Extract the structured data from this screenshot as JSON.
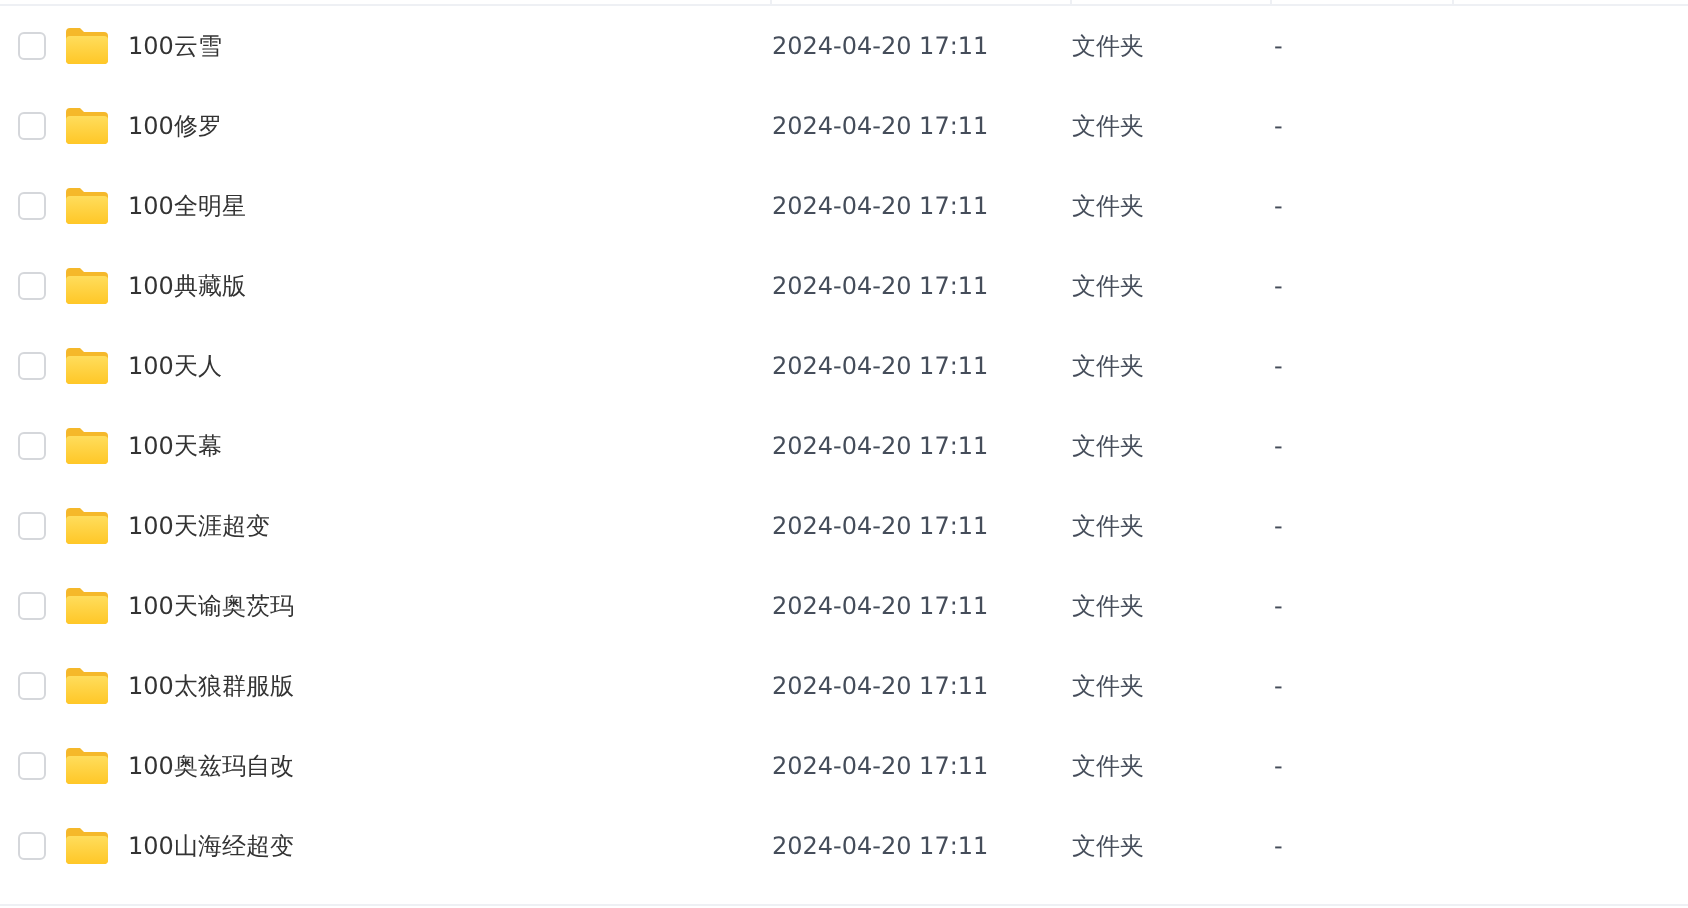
{
  "files": [
    {
      "name": "100云雪",
      "modified": "2024-04-20 17:11",
      "type": "文件夹",
      "size": "-",
      "checked": false
    },
    {
      "name": "100修罗",
      "modified": "2024-04-20 17:11",
      "type": "文件夹",
      "size": "-",
      "checked": false
    },
    {
      "name": "100全明星",
      "modified": "2024-04-20 17:11",
      "type": "文件夹",
      "size": "-",
      "checked": false
    },
    {
      "name": "100典藏版",
      "modified": "2024-04-20 17:11",
      "type": "文件夹",
      "size": "-",
      "checked": false
    },
    {
      "name": "100天人",
      "modified": "2024-04-20 17:11",
      "type": "文件夹",
      "size": "-",
      "checked": false
    },
    {
      "name": "100天幕",
      "modified": "2024-04-20 17:11",
      "type": "文件夹",
      "size": "-",
      "checked": false
    },
    {
      "name": "100天涯超变",
      "modified": "2024-04-20 17:11",
      "type": "文件夹",
      "size": "-",
      "checked": false
    },
    {
      "name": "100天谕奥茨玛",
      "modified": "2024-04-20 17:11",
      "type": "文件夹",
      "size": "-",
      "checked": false
    },
    {
      "name": "100太狼群服版",
      "modified": "2024-04-20 17:11",
      "type": "文件夹",
      "size": "-",
      "checked": false
    },
    {
      "name": "100奥兹玛自改",
      "modified": "2024-04-20 17:11",
      "type": "文件夹",
      "size": "-",
      "checked": false
    },
    {
      "name": "100山海经超变",
      "modified": "2024-04-20 17:11",
      "type": "文件夹",
      "size": "-",
      "checked": false
    }
  ]
}
